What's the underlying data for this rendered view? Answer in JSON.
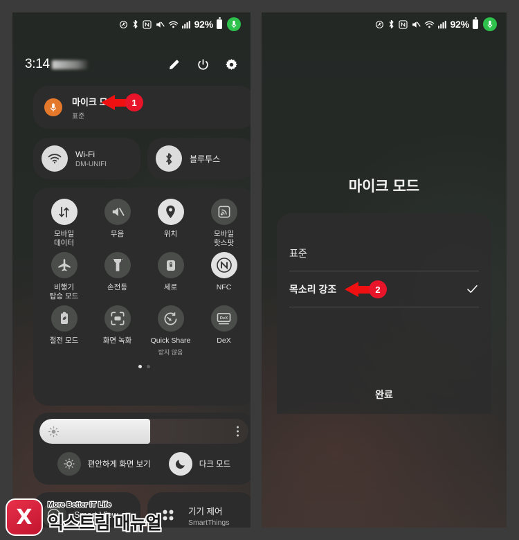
{
  "status_bar": {
    "icons": [
      "dnd-icon",
      "bluetooth-icon",
      "nfc-icon",
      "mute-icon",
      "wifi-calling-icon",
      "signal-icon"
    ],
    "battery_percent": "92%",
    "mic_indicator": "microphone-icon"
  },
  "left_panel": {
    "time": "3:14",
    "actions": [
      "edit-pencil-icon",
      "power-icon",
      "settings-gear-icon"
    ],
    "mic_card": {
      "title": "마이크 모드",
      "subtitle": "표준",
      "icon": "microphone-icon"
    },
    "connectivity": [
      {
        "title": "Wi-Fi",
        "subtitle": "DM-UNIFI",
        "icon": "wifi-icon",
        "state": "on"
      },
      {
        "title": "블루투스",
        "subtitle": "",
        "icon": "bluetooth-icon",
        "state": "on"
      }
    ],
    "tiles": [
      {
        "label": "모바일\n데이터",
        "icon": "data-transfer-icon",
        "state": "on"
      },
      {
        "label": "무음",
        "icon": "mute-speaker-icon",
        "state": "off"
      },
      {
        "label": "위치",
        "icon": "location-pin-icon",
        "state": "on"
      },
      {
        "label": "모바일\n핫스팟",
        "icon": "hotspot-icon",
        "state": "off"
      },
      {
        "label": "비행기\n탑승 모드",
        "icon": "airplane-icon",
        "state": "off"
      },
      {
        "label": "손전등",
        "icon": "flashlight-icon",
        "state": "off"
      },
      {
        "label": "세로",
        "icon": "rotation-lock-icon",
        "state": "off"
      },
      {
        "label": "NFC",
        "icon": "nfc-icon",
        "state": "on"
      },
      {
        "label": "절전 모드",
        "icon": "battery-saver-icon",
        "state": "off"
      },
      {
        "label": "화면 녹화",
        "icon": "screen-record-icon",
        "state": "off"
      },
      {
        "label": "Quick Share",
        "sub": "받지 않음",
        "icon": "quick-share-icon",
        "state": "off"
      },
      {
        "label": "DeX",
        "icon": "dex-icon",
        "state": "off"
      }
    ],
    "page_dots": {
      "count": 2,
      "active": 0
    },
    "brightness": {
      "value_percent": 53,
      "icon": "brightness-icon",
      "menu": "more-options-icon"
    },
    "brightness_row": [
      {
        "label": "편안하게 화면 보기",
        "icon": "eye-comfort-icon",
        "state": "off"
      },
      {
        "label": "다크 모드",
        "icon": "moon-icon",
        "state": "on"
      }
    ],
    "bottom_cards": [
      {
        "title": "Smart View",
        "subtitle": "",
        "icon": "smart-view-icon"
      },
      {
        "title": "기기 제어",
        "subtitle": "SmartThings",
        "icon": "device-control-icon"
      }
    ]
  },
  "right_panel": {
    "dialog_title": "마이크 모드",
    "options": [
      {
        "label": "표준",
        "selected": false
      },
      {
        "label": "목소리 강조",
        "selected": true
      }
    ],
    "done_label": "완료",
    "check_icon": "checkmark-icon"
  },
  "annotations": [
    {
      "number": "1",
      "target": "마이크 모드"
    },
    {
      "number": "2",
      "target": "목소리 강조"
    }
  ],
  "watermark": {
    "logo_letter": "X",
    "tagline": "More Better IT Life",
    "name": "익스트림 매뉴얼"
  },
  "colors": {
    "accent_red": "#e8142a",
    "mic_orange": "#e4792c",
    "mic_green": "#2ec24d",
    "card_bg": "#2c2c2c",
    "panel_bg": "#262a27"
  }
}
